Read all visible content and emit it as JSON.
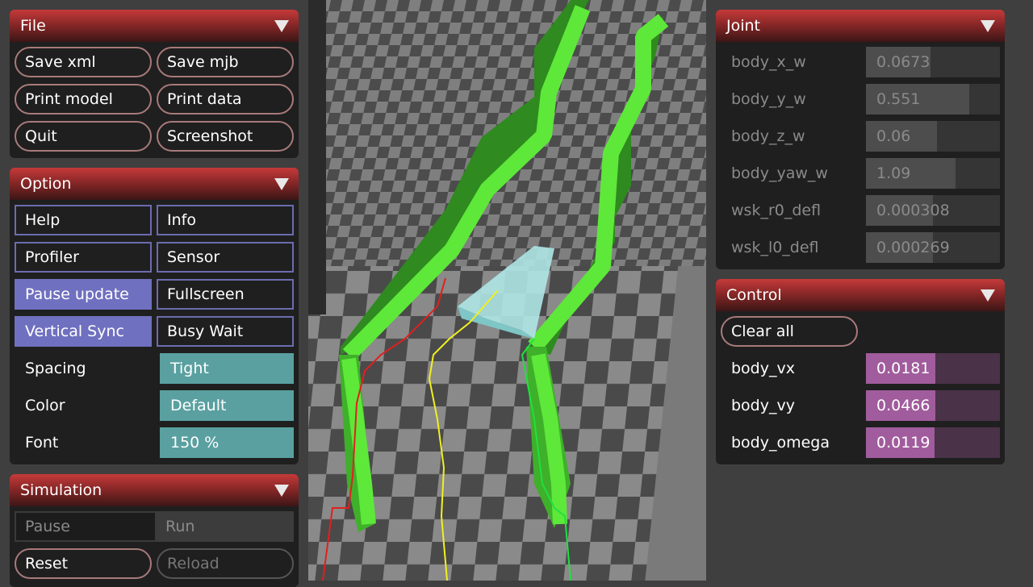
{
  "file_panel": {
    "title": "File",
    "buttons": [
      "Save xml",
      "Save mjb",
      "Print model",
      "Print data",
      "Quit",
      "Screenshot"
    ]
  },
  "option_panel": {
    "title": "Option",
    "toggles": [
      {
        "label": "Help",
        "on": false
      },
      {
        "label": "Info",
        "on": false
      },
      {
        "label": "Profiler",
        "on": false
      },
      {
        "label": "Sensor",
        "on": false
      },
      {
        "label": "Pause update",
        "on": true
      },
      {
        "label": "Fullscreen",
        "on": false
      },
      {
        "label": "Vertical Sync",
        "on": true
      },
      {
        "label": "Busy Wait",
        "on": false
      }
    ],
    "spacing_label": "Spacing",
    "spacing_value": "Tight",
    "color_label": "Color",
    "color_value": "Default",
    "font_label": "Font",
    "font_value": "150 %"
  },
  "simulation_panel": {
    "title": "Simulation",
    "pause_label": "Pause",
    "run_label": "Run",
    "reset_label": "Reset",
    "reload_label": "Reload"
  },
  "joint_panel": {
    "title": "Joint",
    "rows": [
      {
        "label": "body_x_w",
        "value": "0.0673",
        "level": 0.48
      },
      {
        "label": "body_y_w",
        "value": "0.551",
        "level": 0.77
      },
      {
        "label": "body_z_w",
        "value": "0.06",
        "level": 0.53
      },
      {
        "label": "body_yaw_w",
        "value": "1.09",
        "level": 0.67
      },
      {
        "label": "wsk_r0_defl",
        "value": "0.000308",
        "level": 0.5
      },
      {
        "label": "wsk_l0_defl",
        "value": "0.000269",
        "level": 0.5
      }
    ]
  },
  "control_panel": {
    "title": "Control",
    "clear_label": "Clear all",
    "rows": [
      {
        "label": "body_vx",
        "value": "0.0181",
        "level": 0.52
      },
      {
        "label": "body_vy",
        "value": "0.0466",
        "level": 0.52
      },
      {
        "label": "body_omega",
        "value": "0.0119",
        "level": 0.51
      }
    ]
  },
  "colors": {
    "header_red": "#c53a3a",
    "toggle_on": "#7070c0",
    "select_teal": "#5aa0a0",
    "slider_purple": "#a05c9c",
    "wall_green": "#55dd33"
  }
}
